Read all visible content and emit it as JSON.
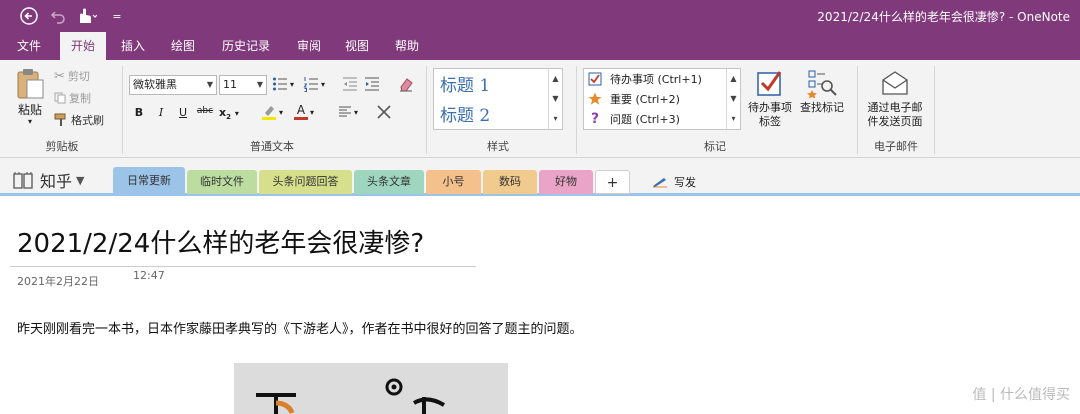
{
  "window": {
    "title": "2021/2/24什么样的老年会很凄惨?  -  OneNote"
  },
  "quick_access": {
    "customize_glyph": "="
  },
  "ribbon_tabs": [
    "文件",
    "开始",
    "插入",
    "绘图",
    "历史记录",
    "审阅",
    "视图",
    "帮助"
  ],
  "clipboard": {
    "paste": "粘贴",
    "cut": "剪切",
    "copy": "复制",
    "format_painter": "格式刷",
    "label": "剪贴板"
  },
  "basic_text": {
    "font": "微软雅黑",
    "size": "11",
    "bold": "B",
    "italic": "I",
    "underline": "U",
    "strike": "abc",
    "subscript": "x",
    "subscript_sub": "2",
    "font_color_letter": "A",
    "label": "普通文本"
  },
  "styles": {
    "items": [
      "标题 1",
      "标题 2"
    ],
    "label": "样式"
  },
  "tags": {
    "items": [
      "待办事项 (Ctrl+1)",
      "重要 (Ctrl+2)",
      "问题 (Ctrl+3)"
    ],
    "question_mark": "?",
    "todo_tag": [
      "待办事项",
      "标签"
    ],
    "find_tags": "查找标记",
    "label": "标记"
  },
  "email": {
    "send": [
      "通过电子邮",
      "件发送页面"
    ],
    "label": "电子邮件"
  },
  "notebook": {
    "name": "知乎",
    "sections": [
      "日常更新",
      "临时文件",
      "头条问题回答",
      "头条文章",
      "小号",
      "数码",
      "好物",
      "+"
    ],
    "write": "写发"
  },
  "page": {
    "title": "2021/2/24什么样的老年会很凄惨?",
    "date": "2021年2月22日",
    "time": "12:47",
    "body": "昨天刚刚看完一本书，日本作家藤田孝典写的《下游老人》，作者在书中很好的回答了题主的问题。"
  },
  "watermark": "值 | 什么值得买",
  "colors": {
    "onenote_purple": "#80397b",
    "ribbon_bg": "#f3f3f3",
    "style_blue": "#3a6fb0",
    "tag_red": "#c0392b",
    "tag_orange": "#e8892c",
    "tag_purple": "#8e44ad"
  }
}
